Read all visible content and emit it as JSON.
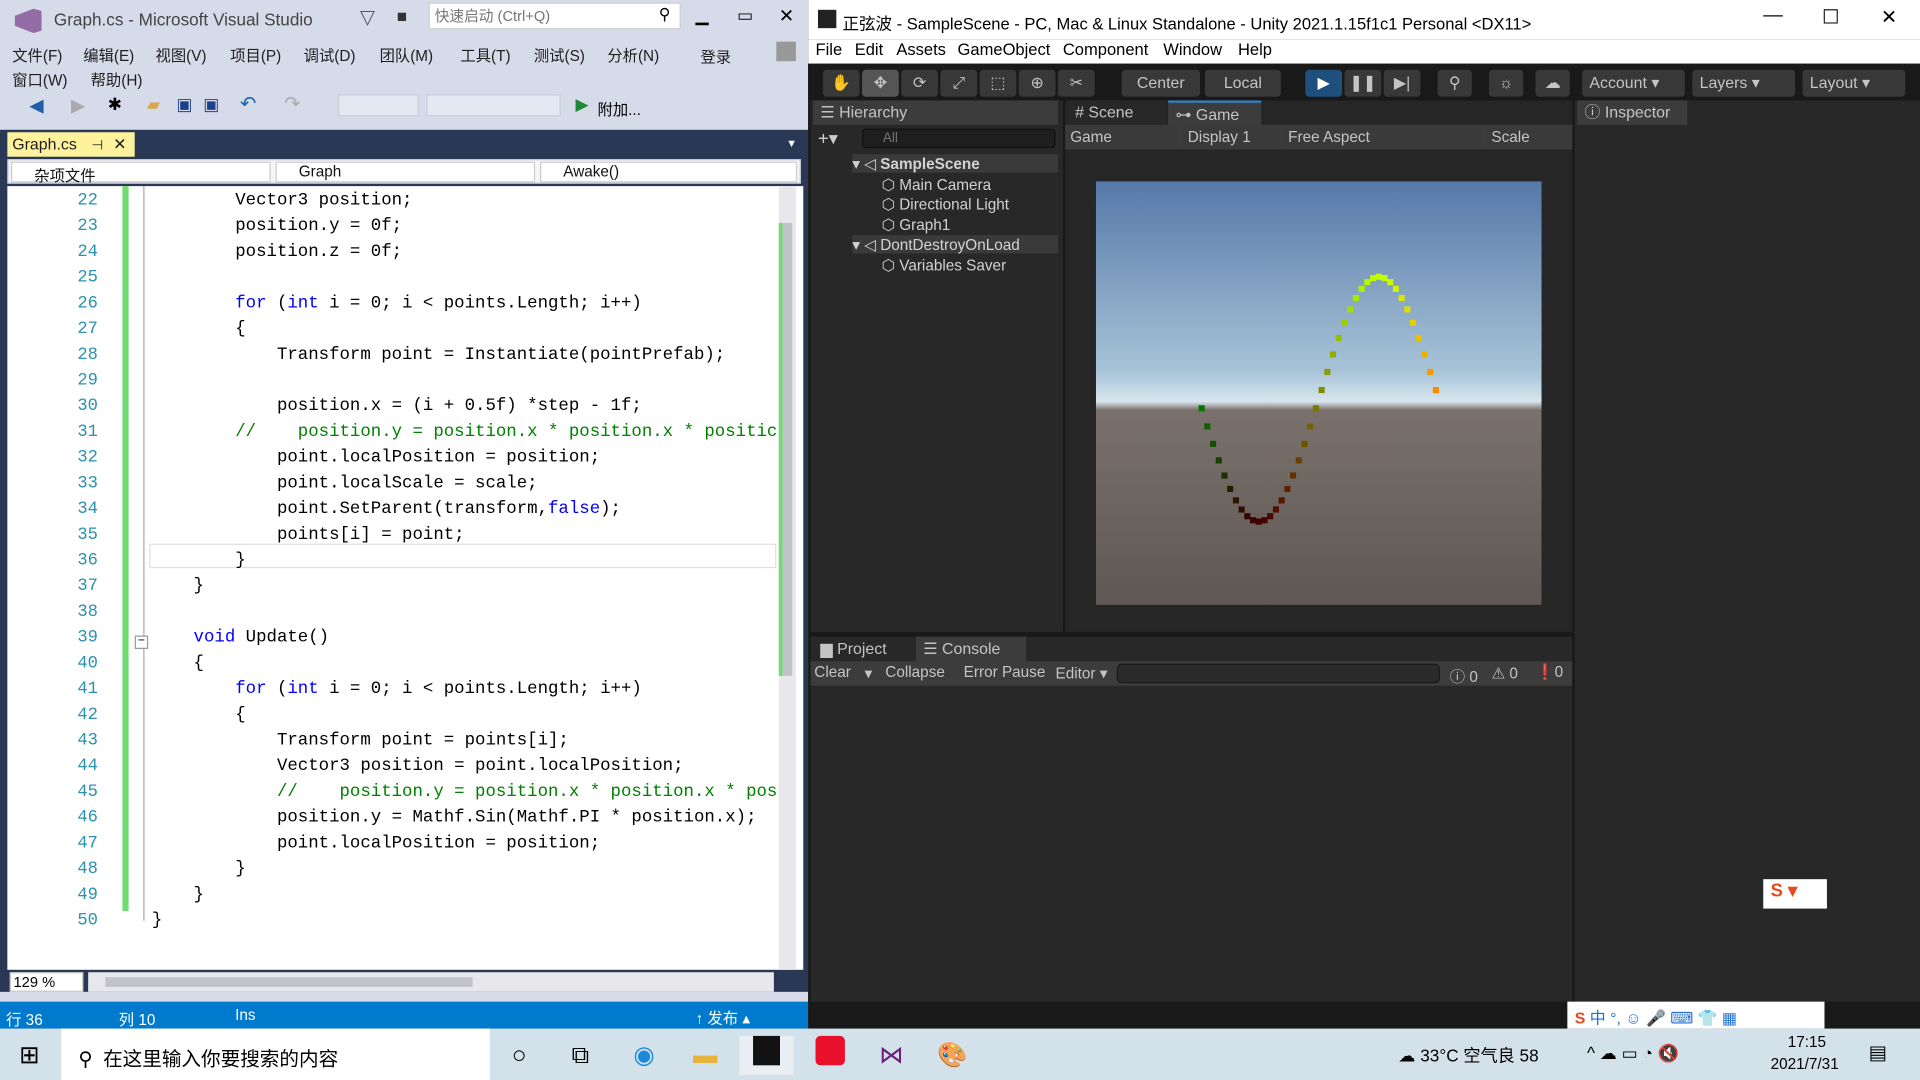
{
  "vs": {
    "title": "Graph.cs - Microsoft Visual Studio",
    "quick_launch_placeholder": "快速启动 (Ctrl+Q)",
    "menu": [
      "文件(F)",
      "编辑(E)",
      "视图(V)",
      "项目(P)",
      "调试(D)",
      "团队(M)",
      "工具(T)",
      "测试(S)",
      "分析(N)",
      "窗口(W)",
      "帮助(H)"
    ],
    "login": "登录",
    "attach_label": "附加...",
    "tab": "Graph.cs",
    "nav": [
      "杂项文件",
      "Graph",
      "Awake()"
    ],
    "zoom": "129 %",
    "status": {
      "line": "行 36",
      "col": "列 10",
      "mode": "Ins",
      "publish": "发布"
    },
    "code": [
      {
        "n": "22",
        "seg": [
          [
            "",
            "        Vector3 position;"
          ]
        ]
      },
      {
        "n": "23",
        "seg": [
          [
            "",
            "        position.y = 0f;"
          ]
        ]
      },
      {
        "n": "24",
        "seg": [
          [
            "",
            "        position.z = 0f;"
          ]
        ]
      },
      {
        "n": "25",
        "seg": []
      },
      {
        "n": "26",
        "seg": [
          [
            "kw",
            "        for"
          ],
          [
            "",
            " ("
          ],
          [
            "kw",
            "int"
          ],
          [
            "",
            " i = 0; i < points.Length; i++)"
          ]
        ]
      },
      {
        "n": "27",
        "seg": [
          [
            "",
            "        {"
          ]
        ]
      },
      {
        "n": "28",
        "seg": [
          [
            "",
            "            Transform point = Instantiate(pointPrefab);"
          ]
        ]
      },
      {
        "n": "29",
        "seg": []
      },
      {
        "n": "30",
        "seg": [
          [
            "",
            "            position.x = (i + 0.5f) *step - 1f;"
          ]
        ]
      },
      {
        "n": "31",
        "seg": [
          [
            "cm",
            "        //    position.y = position.x * position.x * positic"
          ]
        ]
      },
      {
        "n": "32",
        "seg": [
          [
            "",
            "            point.localPosition = position;"
          ]
        ]
      },
      {
        "n": "33",
        "seg": [
          [
            "",
            "            point.localScale = scale;"
          ]
        ]
      },
      {
        "n": "34",
        "seg": [
          [
            "",
            "            point.SetParent(transform,"
          ],
          [
            "kw",
            "false"
          ],
          [
            "",
            ");"
          ]
        ]
      },
      {
        "n": "35",
        "seg": [
          [
            "",
            "            points[i] = point;"
          ]
        ]
      },
      {
        "n": "36",
        "seg": [
          [
            "",
            "        }"
          ]
        ]
      },
      {
        "n": "37",
        "seg": [
          [
            "",
            "    }"
          ]
        ]
      },
      {
        "n": "38",
        "seg": []
      },
      {
        "n": "39",
        "seg": [
          [
            "kw",
            "    void"
          ],
          [
            "",
            " Update()"
          ]
        ]
      },
      {
        "n": "40",
        "seg": [
          [
            "",
            "    {"
          ]
        ]
      },
      {
        "n": "41",
        "seg": [
          [
            "kw",
            "        for"
          ],
          [
            "",
            " ("
          ],
          [
            "kw",
            "int"
          ],
          [
            "",
            " i = 0; i < points.Length; i++)"
          ]
        ]
      },
      {
        "n": "42",
        "seg": [
          [
            "",
            "        {"
          ]
        ]
      },
      {
        "n": "43",
        "seg": [
          [
            "",
            "            Transform point = points[i];"
          ]
        ]
      },
      {
        "n": "44",
        "seg": [
          [
            "",
            "            Vector3 position = point.localPosition;"
          ]
        ]
      },
      {
        "n": "45",
        "seg": [
          [
            "cm",
            "            //    position.y = position.x * position.x * pos"
          ]
        ]
      },
      {
        "n": "46",
        "seg": [
          [
            "",
            "            position.y = Mathf.Sin(Mathf.PI * position.x);"
          ]
        ]
      },
      {
        "n": "47",
        "seg": [
          [
            "",
            "            point.localPosition = position;"
          ]
        ]
      },
      {
        "n": "48",
        "seg": [
          [
            "",
            "        }"
          ]
        ]
      },
      {
        "n": "49",
        "seg": [
          [
            "",
            "    }"
          ]
        ]
      },
      {
        "n": "50",
        "seg": [
          [
            "",
            "}"
          ]
        ]
      }
    ]
  },
  "unity": {
    "title": "正弦波 - SampleScene - PC, Mac & Linux Standalone - Unity 2021.1.15f1c1 Personal <DX11>",
    "menu": [
      "File",
      "Edit",
      "Assets",
      "GameObject",
      "Component",
      "Window",
      "Help"
    ],
    "pivot": "Center",
    "space": "Local",
    "account": "Account",
    "layers": "Layers",
    "layout": "Layout",
    "hierarchy": {
      "tab": "Hierarchy",
      "search_placeholder": "All",
      "items": [
        {
          "label": "SampleScene",
          "depth": 0,
          "scene": true
        },
        {
          "label": "Main Camera",
          "depth": 1
        },
        {
          "label": "Directional Light",
          "depth": 1
        },
        {
          "label": "Graph1",
          "depth": 1
        },
        {
          "label": "DontDestroyOnLoad",
          "depth": 0,
          "scene": true
        },
        {
          "label": "Variables Saver",
          "depth": 1
        }
      ]
    },
    "scene_tab": "Scene",
    "game_tab": "Game",
    "game_bar": {
      "mode": "Game",
      "display": "Display 1",
      "aspect": "Free Aspect",
      "scale": "Scale"
    },
    "inspector_tab": "Inspector",
    "project_tab": "Project",
    "console_tab": "Console",
    "console": {
      "clear": "Clear",
      "collapse": "Collapse",
      "error_pause": "Error Pause",
      "editor": "Editor",
      "log_count": "0",
      "warn_count": "0",
      "error_count": "0"
    }
  },
  "taskbar": {
    "search_placeholder": "在这里输入你要搜索的内容",
    "weather": "33°C 空气良 58",
    "time": "17:15",
    "date": "2021/7/31"
  },
  "colors": {
    "vs_accent": "#007acc",
    "unity_play": "#1f4f7d",
    "tab_active": "#fff29d"
  }
}
